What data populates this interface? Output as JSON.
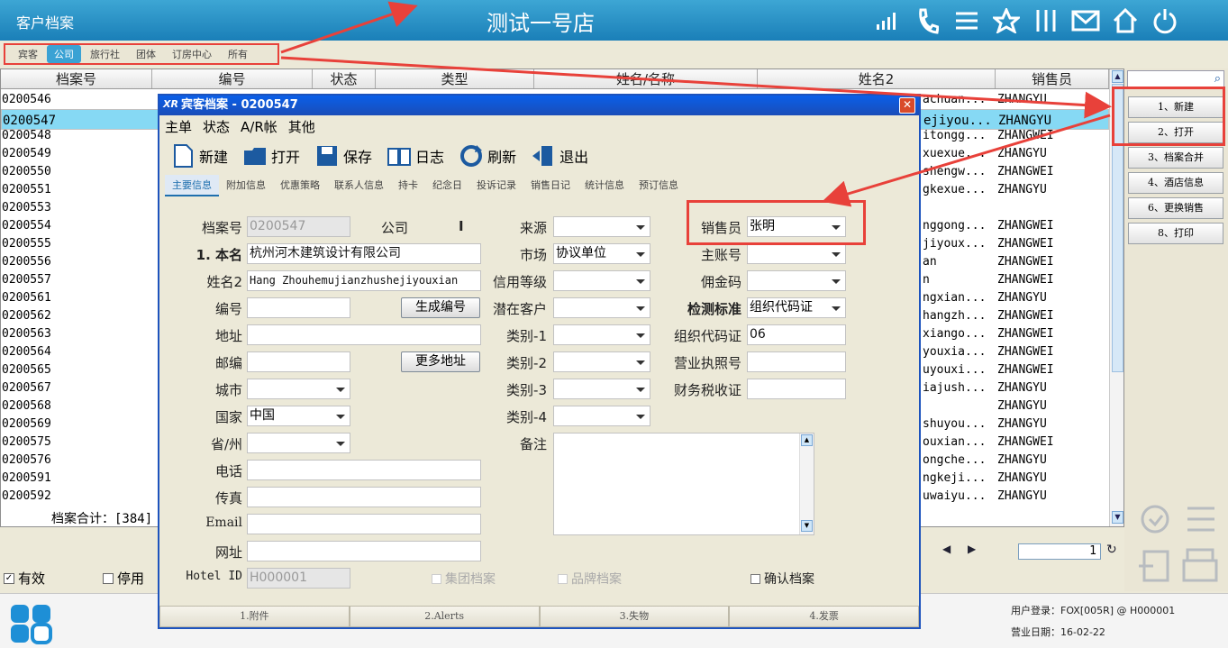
{
  "topbar": {
    "app_title": "客户档案",
    "store_title": "测试一号店"
  },
  "top_icons": [
    "signal-icon",
    "phone-icon",
    "menu-icon",
    "star-icon",
    "columns-icon",
    "mail-icon",
    "home-icon",
    "power-icon"
  ],
  "category_tabs": [
    "宾客",
    "公司",
    "旅行社",
    "团体",
    "订房中心",
    "所有"
  ],
  "category_active_index": 1,
  "grid": {
    "headers": [
      "档案号",
      "编号",
      "状态",
      "类型",
      "姓名/名称",
      "姓名2",
      "销售员"
    ],
    "rows": [
      {
        "id": "0200546",
        "name2": "achuan...",
        "sales": "ZHANGYU"
      },
      {
        "id": "0200547",
        "name2": "ejiyou...",
        "sales": "ZHANGYU"
      },
      {
        "id": "0200548",
        "name2": "itongg...",
        "sales": "ZHANGWEI"
      },
      {
        "id": "0200549",
        "name2": "xuexue...",
        "sales": "ZHANGYU"
      },
      {
        "id": "0200550",
        "name2": "shengw...",
        "sales": "ZHANGWEI"
      },
      {
        "id": "0200551",
        "name2": "gkexue...",
        "sales": "ZHANGYU"
      },
      {
        "id": "0200553",
        "name2": "",
        "sales": ""
      },
      {
        "id": "0200554",
        "name2": "nggong...",
        "sales": "ZHANGWEI"
      },
      {
        "id": "0200555",
        "name2": "jiyoux...",
        "sales": "ZHANGWEI"
      },
      {
        "id": "0200556",
        "name2": "an",
        "sales": "ZHANGWEI"
      },
      {
        "id": "0200557",
        "name2": "n",
        "sales": "ZHANGWEI"
      },
      {
        "id": "0200561",
        "name2": "ngxian...",
        "sales": "ZHANGYU"
      },
      {
        "id": "0200562",
        "name2": "hangzh...",
        "sales": "ZHANGWEI"
      },
      {
        "id": "0200563",
        "name2": "xiango...",
        "sales": "ZHANGWEI"
      },
      {
        "id": "0200564",
        "name2": "youxia...",
        "sales": "ZHANGWEI"
      },
      {
        "id": "0200565",
        "name2": "uyouxi...",
        "sales": "ZHANGWEI"
      },
      {
        "id": "0200567",
        "name2": "iajush...",
        "sales": "ZHANGYU"
      },
      {
        "id": "0200568",
        "name2": "",
        "sales": "ZHANGYU"
      },
      {
        "id": "0200569",
        "name2": "shuyou...",
        "sales": "ZHANGYU"
      },
      {
        "id": "0200575",
        "name2": "ouxian...",
        "sales": "ZHANGWEI"
      },
      {
        "id": "0200576",
        "name2": "ongche...",
        "sales": "ZHANGYU"
      },
      {
        "id": "0200591",
        "name2": "ngkeji...",
        "sales": "ZHANGYU"
      },
      {
        "id": "0200592",
        "name2": "uwaiyu...",
        "sales": "ZHANGYU"
      }
    ],
    "selected_row": 1,
    "total_label": "档案合计：[384]"
  },
  "pager": {
    "page": "1"
  },
  "right_panel": {
    "buttons": [
      "1、新建",
      "2、打开",
      "3、档案合并",
      "4、酒店信息",
      "6、更换销售",
      "8、打印"
    ]
  },
  "bottom_checks": {
    "valid": "有效",
    "valid_checked": true,
    "disabled": "停用",
    "disabled_checked": false
  },
  "status": {
    "login": "用户登录：FOX[005R] @ H000001",
    "bizdate": "营业日期：16-02-22"
  },
  "dialog": {
    "title": "宾客档案 - 0200547",
    "logo": "XR",
    "close": "✕",
    "menu": [
      "主单",
      "状态",
      "A/R帐",
      "其他"
    ],
    "toolbar": [
      "新建",
      "打开",
      "保存",
      "日志",
      "刷新",
      "退出"
    ],
    "tabs": [
      "主要信息",
      "附加信息",
      "优惠策略",
      "联系人信息",
      "持卡",
      "纪念日",
      "投诉记录",
      "销售日记",
      "统计信息",
      "预订信息"
    ],
    "labels": {
      "file_no": "档案号",
      "company": "公司",
      "status_mark": "I",
      "name": "1. 本名",
      "name2": "姓名2",
      "code": "编号",
      "address": "地址",
      "zip": "邮编",
      "city": "城市",
      "country": "国家",
      "province": "省/州",
      "phone": "电话",
      "fax": "传真",
      "email": "Email",
      "website": "网址",
      "hotel_id": "Hotel ID",
      "source": "来源",
      "market": "市场",
      "credit": "信用等级",
      "potential": "潜在客户",
      "cat1": "类别-1",
      "cat2": "类别-2",
      "cat3": "类别-3",
      "cat4": "类别-4",
      "remarks": "备注",
      "sales": "销售员",
      "main_acct": "主账号",
      "commission": "佣金码",
      "check_std": "检测标准",
      "org_code": "组织代码证",
      "biz_license": "营业执照号",
      "tax_cert": "财务税收证"
    },
    "values": {
      "file_no": "0200547",
      "name": "杭州河木建筑设计有限公司",
      "name2": "Hang Zhouhemujianzhushejiyouxian",
      "country": "中国",
      "hotel_id": "H000001",
      "market": "协议单位",
      "sales": "张明",
      "check_std": "组织代码证",
      "org_code": "06"
    },
    "buttons": {
      "gen_code": "生成编号",
      "more_addr": "更多地址"
    },
    "checks": {
      "group": "集团档案",
      "brand": "品牌档案",
      "confirm": "确认档案"
    },
    "bottom_tabs": [
      "1.附件",
      "2.Alerts",
      "3.失物",
      "4.发票"
    ]
  },
  "colors": {
    "topbar": "#1a7fb8",
    "accent_red": "#e8413a",
    "selected_row": "#86d9f4",
    "dialog_title": "#0a5fe8"
  }
}
